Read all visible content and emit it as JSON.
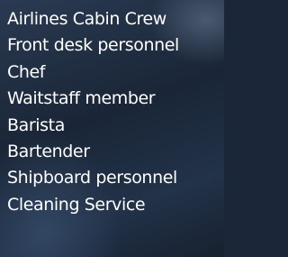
{
  "job_list": {
    "items": [
      {
        "label": "Airlines Cabin Crew"
      },
      {
        "label": "Front desk personnel"
      },
      {
        "label": "Chef"
      },
      {
        "label": "Waitstaff member"
      },
      {
        "label": "Barista"
      },
      {
        "label": "Bartender"
      },
      {
        "label": "Shipboard personnel"
      },
      {
        "label": "Cleaning Service"
      }
    ]
  },
  "colors": {
    "text": "#ffffff",
    "background": "#1b2738"
  }
}
